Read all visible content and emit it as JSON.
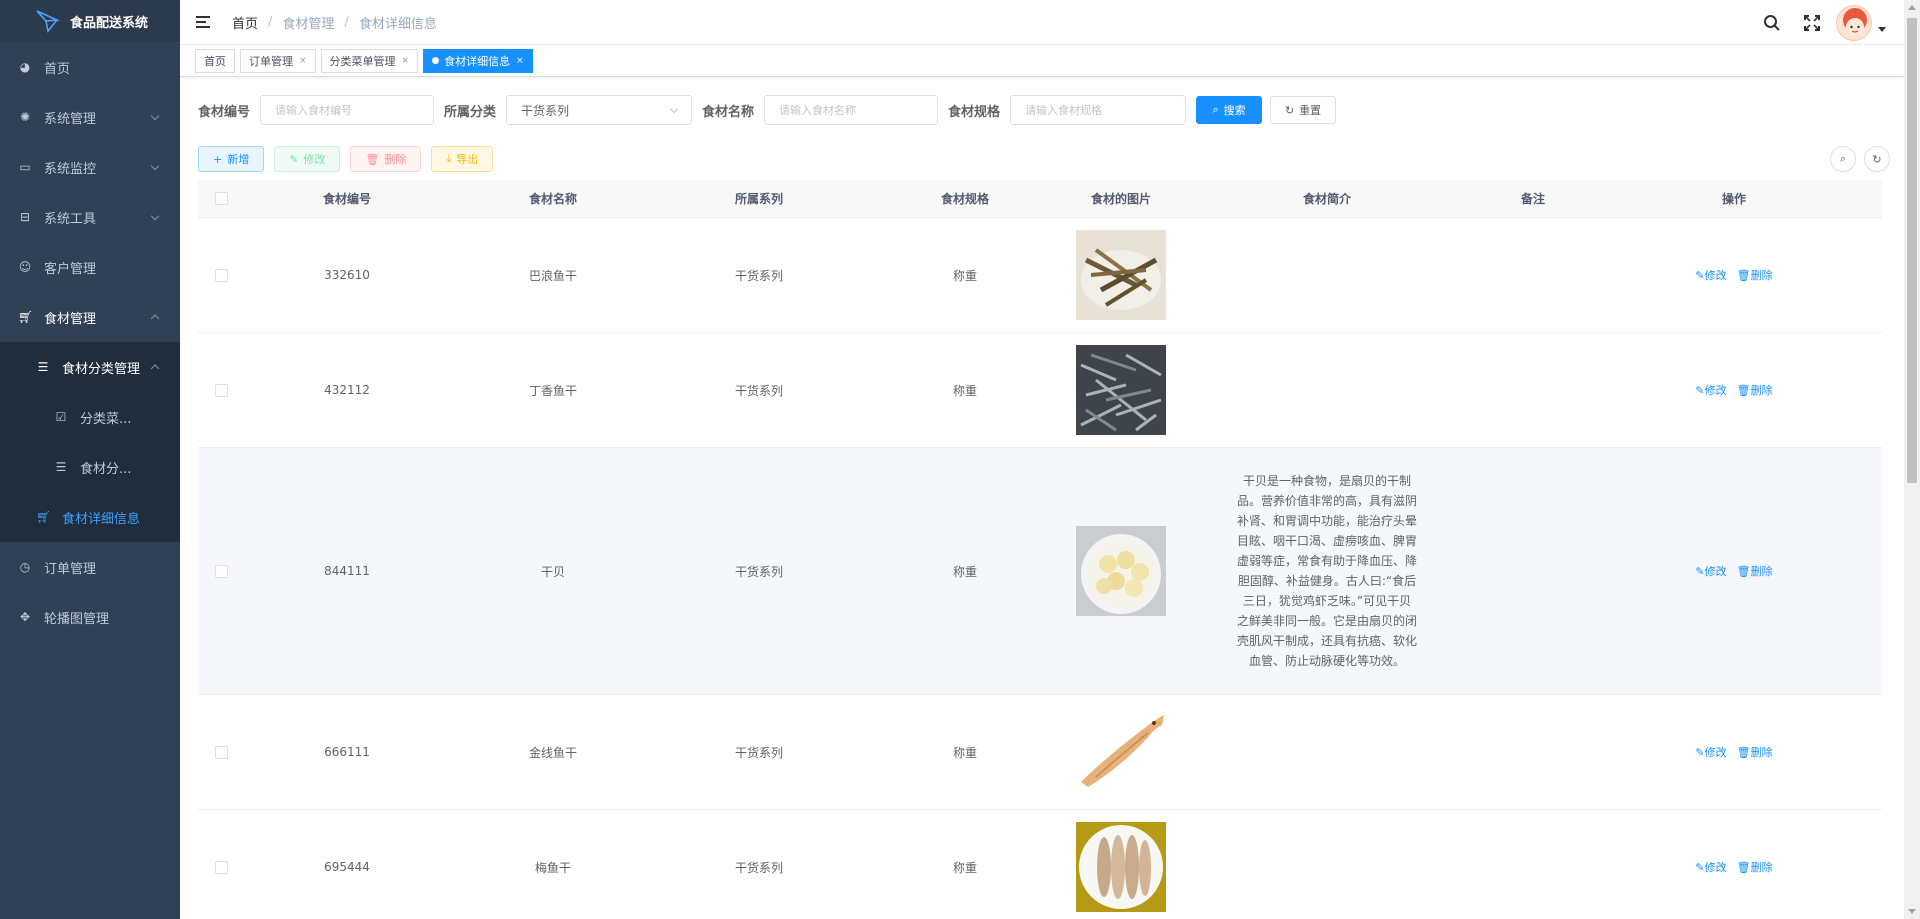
{
  "app": {
    "title": "食品配送系统"
  },
  "sidebar": {
    "items": [
      {
        "label": "首页",
        "icon": "dashboard-icon"
      },
      {
        "label": "系统管理",
        "icon": "gear-icon"
      },
      {
        "label": "系统监控",
        "icon": "monitor-icon"
      },
      {
        "label": "系统工具",
        "icon": "toolbox-icon"
      },
      {
        "label": "客户管理",
        "icon": "user-icon"
      },
      {
        "label": "食材管理",
        "icon": "cart-icon"
      },
      {
        "label": "食材分类管理",
        "icon": "list-icon"
      },
      {
        "label": "分类菜...",
        "icon": "checkbox-icon"
      },
      {
        "label": "食材分...",
        "icon": "list-icon"
      },
      {
        "label": "食材详细信息",
        "icon": "cart-icon"
      },
      {
        "label": "订单管理",
        "icon": "clock-icon"
      },
      {
        "label": "轮播图管理",
        "icon": "move-icon"
      }
    ]
  },
  "breadcrumb": [
    "首页",
    "食材管理",
    "食材详细信息"
  ],
  "tags": [
    {
      "label": "首页"
    },
    {
      "label": "订单管理"
    },
    {
      "label": "分类菜单管理"
    },
    {
      "label": "食材详细信息"
    }
  ],
  "search": {
    "code_label": "食材编号",
    "code_placeholder": "请输入食材编号",
    "category_label": "所属分类",
    "category_value": "干货系列",
    "name_label": "食材名称",
    "name_placeholder": "请输入食材名称",
    "spec_label": "食材规格",
    "spec_placeholder": "请输入食材规格",
    "search_btn": "搜索",
    "reset_btn": "重置"
  },
  "toolbar": {
    "add": "新增",
    "edit": "修改",
    "delete": "删除",
    "export": "导出"
  },
  "table": {
    "headers": [
      "食材编号",
      "食材名称",
      "所属系列",
      "食材规格",
      "食材的图片",
      "食材简介",
      "备注",
      "操作"
    ],
    "edit_label": "修改",
    "delete_label": "删除",
    "rows": [
      {
        "code": "332610",
        "name": "巴浪鱼干",
        "series": "干货系列",
        "spec": "称重",
        "desc": "",
        "note": ""
      },
      {
        "code": "432112",
        "name": "丁香鱼干",
        "series": "干货系列",
        "spec": "称重",
        "desc": "",
        "note": ""
      },
      {
        "code": "844111",
        "name": "干贝",
        "series": "干货系列",
        "spec": "称重",
        "desc": "干贝是一种食物，是扇贝的干制品。营养价值非常的高，具有滋阴补肾、和胃调中功能，能治疗头晕目眩、咽干口渴、虚痨咳血、脾胃虚弱等症，常食有助于降血压、降胆固醇、补益健身。古人曰:“食后三日，犹觉鸡虾乏味。”可见干贝之鲜美非同一般。它是由扇贝的闭壳肌风干制成，还具有抗癌、软化血管、防止动脉硬化等功效。",
        "note": ""
      },
      {
        "code": "666111",
        "name": "金线鱼干",
        "series": "干货系列",
        "spec": "称重",
        "desc": "",
        "note": ""
      },
      {
        "code": "695444",
        "name": "梅鱼干",
        "series": "干货系列",
        "spec": "称重",
        "desc": "",
        "note": ""
      }
    ]
  },
  "colors": {
    "sidebar_bg": "#304156",
    "primary": "#1890ff",
    "active_menu": "#409eff"
  }
}
